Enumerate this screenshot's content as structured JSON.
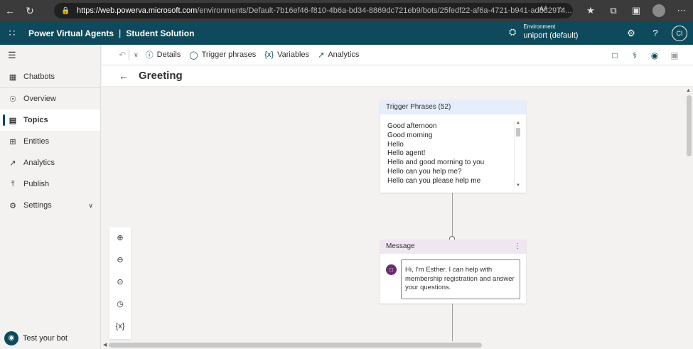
{
  "browser": {
    "url_host": "https://web.powerva.microsoft.com",
    "url_path": "/environments/Default-7b16ef46-f810-4b6a-bd34-8869dc721eb9/bots/25fedf22-af6a-4721-b941-adb82974...",
    "aa_label": "Aᴬ"
  },
  "app": {
    "name": "Power Virtual Agents",
    "separator": "|",
    "solution": "Student Solution",
    "env_label": "Environment",
    "env_value": "uniport (default)",
    "avatar_initials": "CI"
  },
  "sidebar": {
    "items": [
      {
        "label": "Chatbots",
        "icon": "▦"
      },
      {
        "label": "Overview",
        "icon": "☉"
      },
      {
        "label": "Topics",
        "icon": "▤"
      },
      {
        "label": "Entities",
        "icon": "⊞"
      },
      {
        "label": "Analytics",
        "icon": "↗"
      },
      {
        "label": "Publish",
        "icon": "⤒"
      },
      {
        "label": "Settings",
        "icon": "⚙"
      }
    ],
    "test_bot": "Test your bot"
  },
  "toolbar": {
    "details": "Details",
    "trigger_phrases": "Trigger phrases",
    "variables": "Variables",
    "analytics": "Analytics"
  },
  "page": {
    "title": "Greeting"
  },
  "trigger_card": {
    "header": "Trigger Phrases (52)",
    "phrases": [
      "Good afternoon",
      "Good morning",
      "Hello",
      "Hello agent!",
      "Hello and good morning to you",
      "Hello can you help me?",
      "Hello can you please help me"
    ]
  },
  "message_card": {
    "header": "Message",
    "text": "Hi, I'm Esther. I can help with membership registration and answer your questions."
  },
  "zoom_controls": {
    "variables_label": "{x}"
  }
}
